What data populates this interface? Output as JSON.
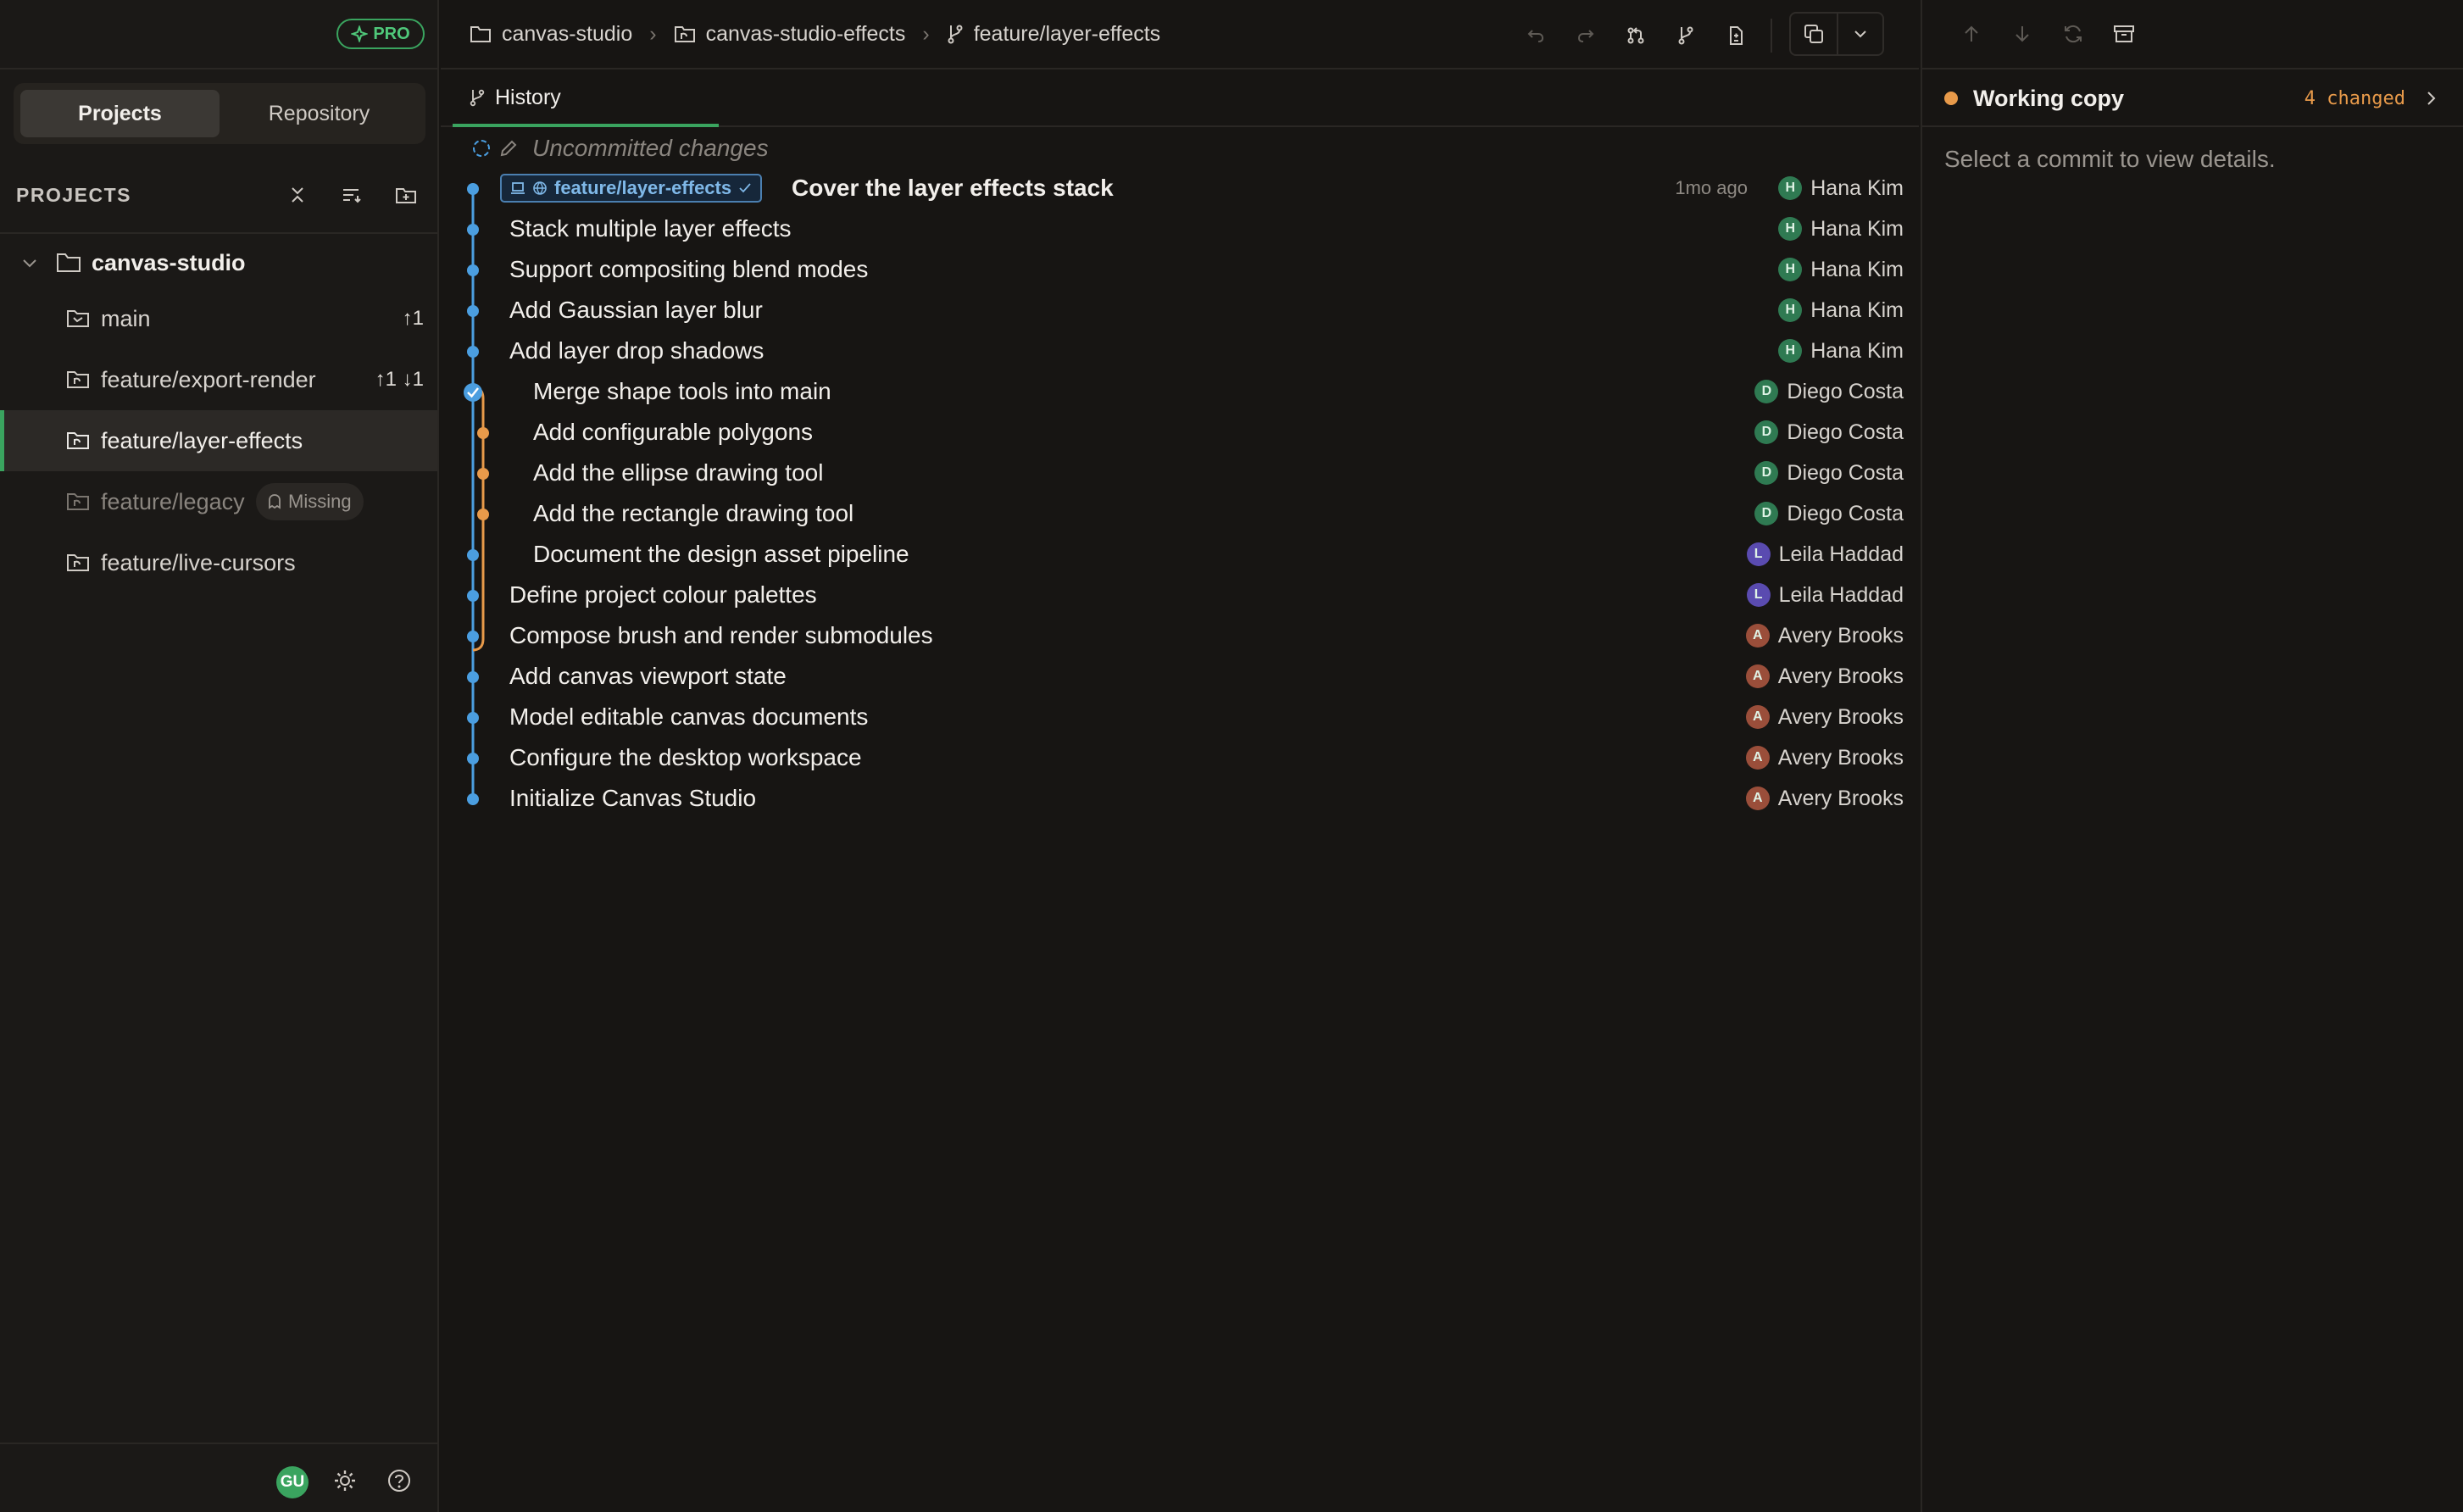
{
  "sidebar": {
    "pro_badge": "PRO",
    "segments": [
      "Projects",
      "Repository"
    ],
    "projects_label": "PROJECTS",
    "project_name": "canvas-studio",
    "branches": [
      {
        "name": "main",
        "count": "↑1"
      },
      {
        "name": "feature/export-render",
        "count": "↑1 ↓1"
      },
      {
        "name": "feature/layer-effects",
        "count": ""
      },
      {
        "name": "feature/legacy",
        "count": "",
        "badge": "Missing"
      },
      {
        "name": "feature/live-cursors",
        "count": ""
      }
    ],
    "user_initials": "GU"
  },
  "toolbar": {
    "breadcrumbs": [
      "canvas-studio",
      "canvas-studio-effects",
      "feature/layer-effects"
    ]
  },
  "tabs": [
    "History"
  ],
  "history": {
    "uncommitted": "Uncommitted changes",
    "head_branch": "feature/layer-effects",
    "commits": [
      {
        "message": "Cover the layer effects stack",
        "author": "Hana Kim",
        "initial": "H",
        "time": "1mo ago"
      },
      {
        "message": "Stack multiple layer effects",
        "author": "Hana Kim",
        "initial": "H"
      },
      {
        "message": "Support compositing blend modes",
        "author": "Hana Kim",
        "initial": "H"
      },
      {
        "message": "Add Gaussian layer blur",
        "author": "Hana Kim",
        "initial": "H"
      },
      {
        "message": "Add layer drop shadows",
        "author": "Hana Kim",
        "initial": "H"
      },
      {
        "message": "Merge shape tools into main",
        "author": "Diego Costa",
        "initial": "D"
      },
      {
        "message": "Add configurable polygons",
        "author": "Diego Costa",
        "initial": "D"
      },
      {
        "message": "Add the ellipse drawing tool",
        "author": "Diego Costa",
        "initial": "D"
      },
      {
        "message": "Add the rectangle drawing tool",
        "author": "Diego Costa",
        "initial": "D"
      },
      {
        "message": "Document the design asset pipeline",
        "author": "Leila Haddad",
        "initial": "L"
      },
      {
        "message": "Define project colour palettes",
        "author": "Leila Haddad",
        "initial": "L"
      },
      {
        "message": "Compose brush and render submodules",
        "author": "Avery Brooks",
        "initial": "A"
      },
      {
        "message": "Add canvas viewport state",
        "author": "Avery Brooks",
        "initial": "A"
      },
      {
        "message": "Model editable canvas documents",
        "author": "Avery Brooks",
        "initial": "A"
      },
      {
        "message": "Configure the desktop workspace",
        "author": "Avery Brooks",
        "initial": "A"
      },
      {
        "message": "Initialize Canvas Studio",
        "author": "Avery Brooks",
        "initial": "A"
      }
    ]
  },
  "right_panel": {
    "working_copy_label": "Working copy",
    "changed_text": "4 changed",
    "empty_text": "Select a commit to view details."
  },
  "colors": {
    "accent_green": "#3aa45f",
    "graph_blue": "#4b9ee0",
    "graph_orange": "#e89a4a",
    "avatar_hana": "#2f7a52",
    "avatar_diego": "#2f7a52",
    "avatar_leila": "#5a4bb0",
    "avatar_avery": "#9a4e3a"
  }
}
